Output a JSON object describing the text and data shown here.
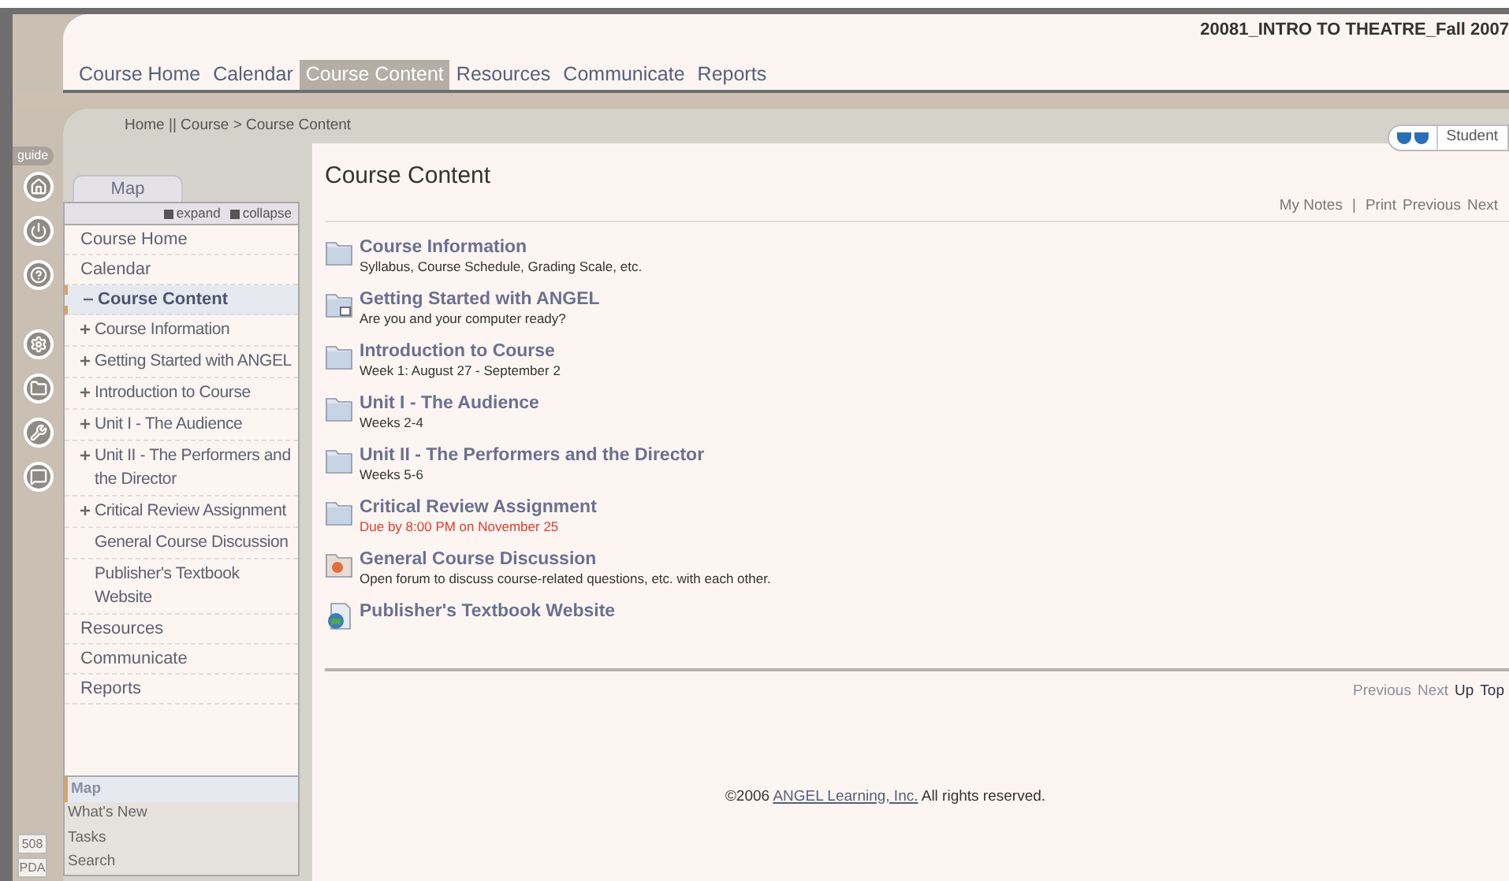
{
  "header": {
    "course_title": "20081_INTRO TO THEATRE_Fall 2007"
  },
  "tabs": [
    {
      "label": "Course Home",
      "selected": false
    },
    {
      "label": "Calendar",
      "selected": false
    },
    {
      "label": "Course Content",
      "selected": true
    },
    {
      "label": "Resources",
      "selected": false
    },
    {
      "label": "Communicate",
      "selected": false
    },
    {
      "label": "Reports",
      "selected": false
    }
  ],
  "breadcrumb": "Home || Course > Course Content",
  "view_toggle": {
    "label": "Student"
  },
  "rail": {
    "guide": "guide",
    "bottom_buttons": [
      "508",
      "PDA"
    ]
  },
  "sidebar": {
    "tab": "Map",
    "expand": "expand",
    "collapse": "collapse",
    "items": [
      {
        "label": "Course Home",
        "selected": false
      },
      {
        "label": "Calendar",
        "selected": false
      },
      {
        "label": "Course Content",
        "selected": true,
        "expanded": true,
        "children": [
          {
            "label": "Course Information",
            "expandable": true
          },
          {
            "label": "Getting Started with ANGEL",
            "expandable": true
          },
          {
            "label": "Introduction to Course",
            "expandable": true
          },
          {
            "label": "Unit I - The Audience",
            "expandable": true
          },
          {
            "label": "Unit II - The Performers and the Director",
            "expandable": true
          },
          {
            "label": "Critical Review Assignment",
            "expandable": true
          },
          {
            "label": "General Course Discussion",
            "expandable": false
          },
          {
            "label": "Publisher's Textbook Website",
            "expandable": false
          }
        ]
      },
      {
        "label": "Resources",
        "selected": false
      },
      {
        "label": "Communicate",
        "selected": false
      },
      {
        "label": "Reports",
        "selected": false
      }
    ],
    "bottom_tabs": [
      {
        "label": "Map",
        "selected": true
      },
      {
        "label": "What's New",
        "selected": false
      },
      {
        "label": "Tasks",
        "selected": false
      },
      {
        "label": "Search",
        "selected": false
      }
    ]
  },
  "content": {
    "title": "Course Content",
    "top_links": [
      {
        "label": "My Notes",
        "kind": "link"
      },
      {
        "label": "|",
        "kind": "separator"
      },
      {
        "label": "Print",
        "kind": "link"
      },
      {
        "label": "Previous",
        "kind": "link"
      },
      {
        "label": "Next",
        "kind": "link"
      }
    ],
    "items": [
      {
        "kind": "folder",
        "title": "Course Information",
        "description": "Syllabus, Course Schedule, Grading Scale, etc.",
        "alert": false
      },
      {
        "kind": "folder-link",
        "title": "Getting Started with ANGEL",
        "description": "Are you and your computer ready?",
        "alert": false
      },
      {
        "kind": "folder",
        "title": "Introduction to Course",
        "description": "Week 1: August 27 - September 2",
        "alert": false
      },
      {
        "kind": "folder",
        "title": "Unit I - The Audience",
        "description": "Weeks 2-4",
        "alert": false
      },
      {
        "kind": "folder",
        "title": "Unit II - The Performers and the Director",
        "description": "Weeks 5-6",
        "alert": false
      },
      {
        "kind": "folder",
        "title": "Critical Review Assignment",
        "description": "Due by 8:00 PM on November 25",
        "alert": true
      },
      {
        "kind": "forum",
        "title": "General Course Discussion",
        "description": "Open forum to discuss course-related questions, etc. with each other.",
        "alert": false
      },
      {
        "kind": "web",
        "title": "Publisher's Textbook Website"
      }
    ],
    "bottom_nav": [
      {
        "label": "Previous",
        "disabled": true
      },
      {
        "label": "Next",
        "disabled": true
      },
      {
        "label": "Up",
        "disabled": false
      },
      {
        "label": "Top",
        "disabled": false
      }
    ],
    "footer": {
      "prefix": "©2006 ",
      "link": "ANGEL Learning, Inc.",
      "suffix": " All rights reserved."
    }
  }
}
